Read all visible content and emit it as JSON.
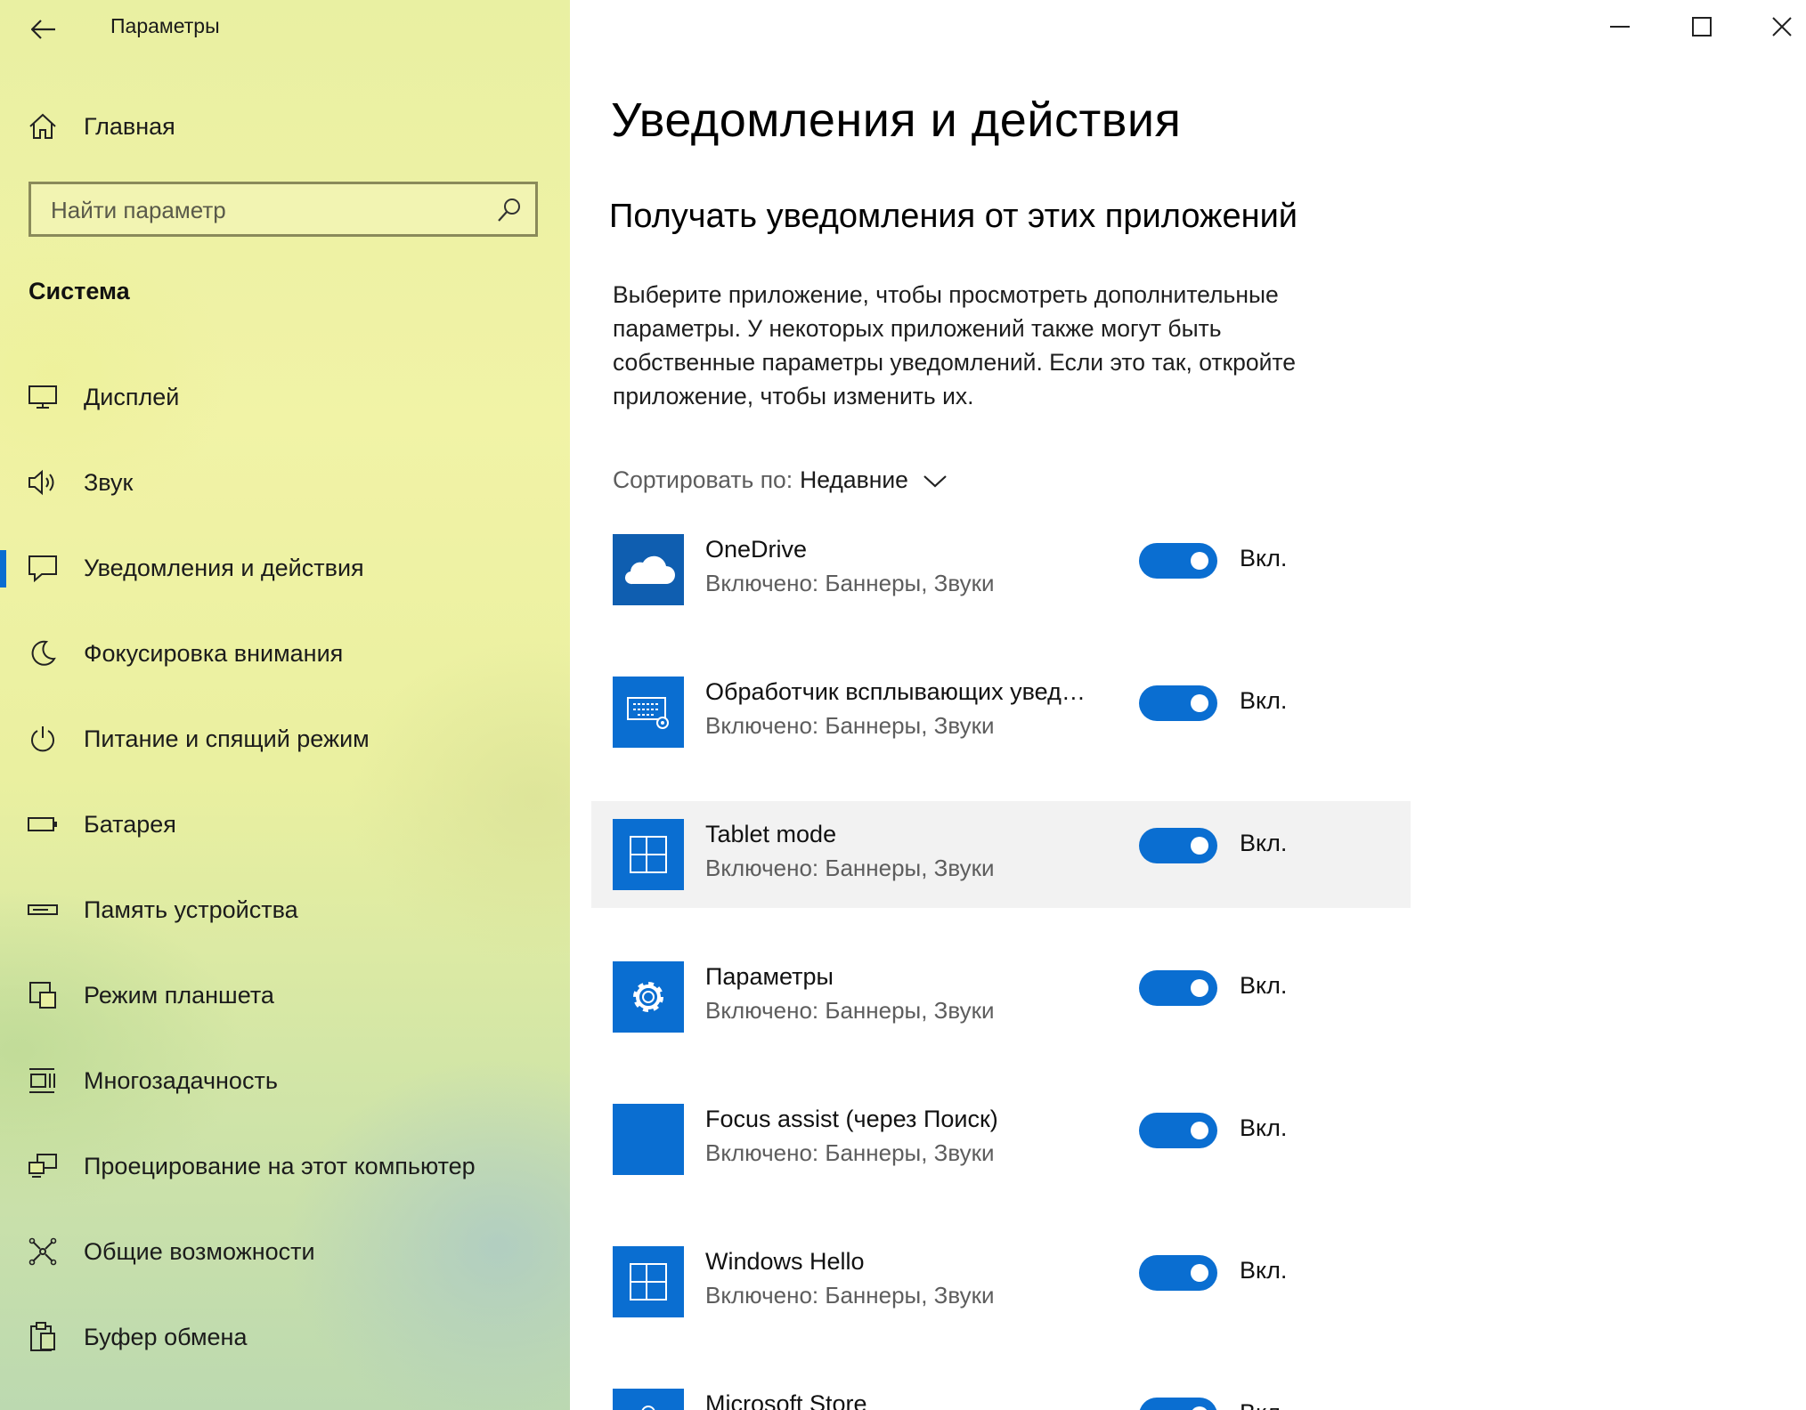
{
  "window": {
    "title": "Параметры"
  },
  "sidebar": {
    "home_label": "Главная",
    "search_placeholder": "Найти параметр",
    "section": "Система",
    "items": [
      {
        "label": "Дисплей",
        "icon": "display-icon"
      },
      {
        "label": "Звук",
        "icon": "speaker-icon"
      },
      {
        "label": "Уведомления и действия",
        "icon": "notifications-icon",
        "active": true
      },
      {
        "label": "Фокусировка внимания",
        "icon": "moon-icon"
      },
      {
        "label": "Питание и спящий режим",
        "icon": "power-icon"
      },
      {
        "label": "Батарея",
        "icon": "battery-icon"
      },
      {
        "label": "Память устройства",
        "icon": "storage-icon"
      },
      {
        "label": "Режим планшета",
        "icon": "tablet-mode-icon"
      },
      {
        "label": "Многозадачность",
        "icon": "multitasking-icon"
      },
      {
        "label": "Проецирование на этот компьютер",
        "icon": "projecting-icon"
      },
      {
        "label": "Общие возможности",
        "icon": "shared-experiences-icon"
      },
      {
        "label": "Буфер обмена",
        "icon": "clipboard-icon"
      }
    ]
  },
  "main": {
    "title": "Уведомления и действия",
    "subtitle": "Получать уведомления от этих приложений",
    "description": "Выберите приложение, чтобы просмотреть дополнительные параметры. У некоторых приложений также могут быть собственные параметры уведомлений. Если это так, откройте приложение, чтобы изменить их.",
    "sort_label": "Сортировать по:",
    "sort_value": "Недавние",
    "apps": [
      {
        "name": "OneDrive",
        "status": "Включено: Баннеры, Звуки",
        "toggle_label": "Вкл.",
        "on": true,
        "icon": "onedrive-cloud-icon"
      },
      {
        "name": "Обработчик всплывающих уведомлений",
        "status": "Включено: Баннеры, Звуки",
        "toggle_label": "Вкл.",
        "on": true,
        "icon": "keyboard-gear-icon"
      },
      {
        "name": "Tablet mode",
        "status": "Включено: Баннеры, Звуки",
        "toggle_label": "Вкл.",
        "on": true,
        "icon": "grid-icon"
      },
      {
        "name": "Параметры",
        "status": "Включено: Баннеры, Звуки",
        "toggle_label": "Вкл.",
        "on": true,
        "icon": "settings-gear-icon"
      },
      {
        "name": "Focus assist (через Поиск)",
        "status": "Включено: Баннеры, Звуки",
        "toggle_label": "Вкл.",
        "on": true,
        "icon": "blank-tile"
      },
      {
        "name": "Windows Hello",
        "status": "Включено: Баннеры, Звуки",
        "toggle_label": "Вкл.",
        "on": true,
        "icon": "grid-icon"
      },
      {
        "name": "Microsoft Store",
        "status": "",
        "toggle_label": "Вкл.",
        "on": true,
        "icon": "store-bag-icon"
      }
    ]
  },
  "colors": {
    "accent": "#0a6ed1",
    "secondary_text": "#5d5d5d"
  }
}
